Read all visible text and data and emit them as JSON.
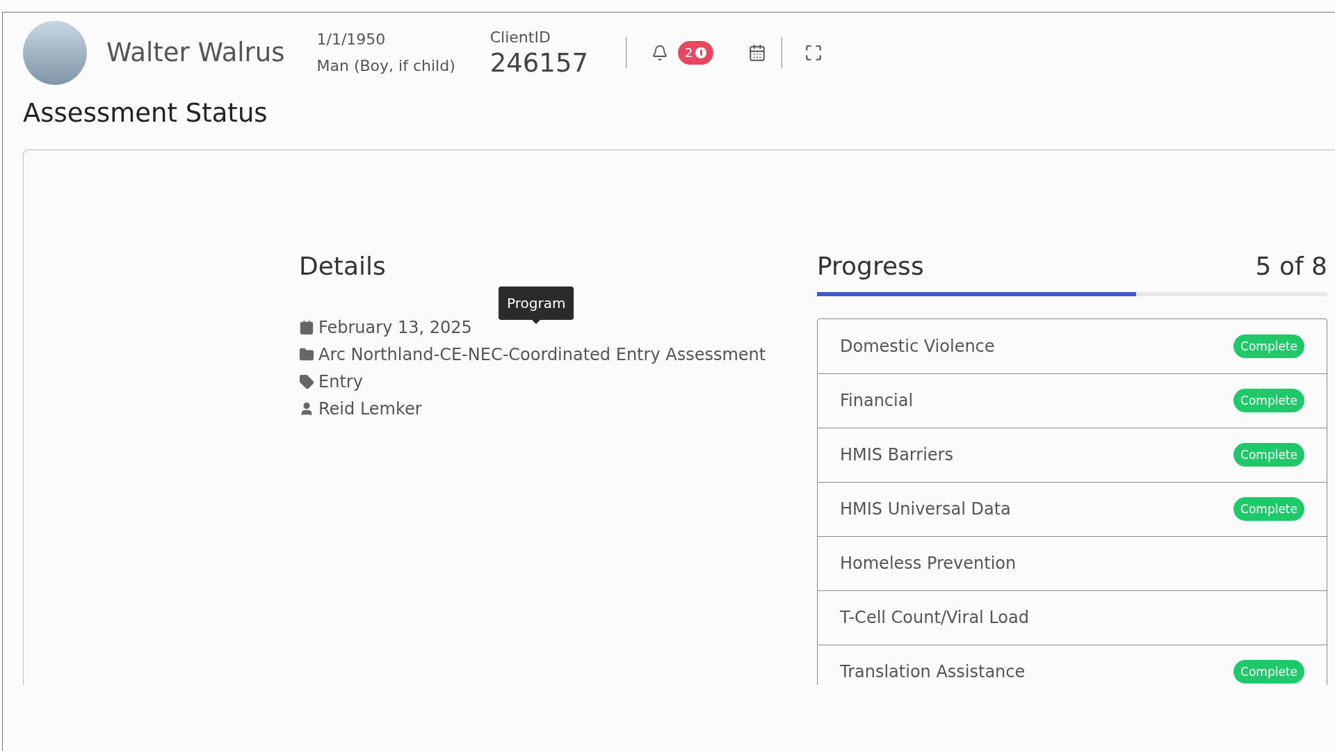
{
  "client": {
    "name": "Walter Walrus",
    "dob": "1/1/1950",
    "gender": "Man (Boy, if child)",
    "id_label": "ClientID",
    "id": "246157",
    "alert_count": "2"
  },
  "page_title": "Assessment Status",
  "details": {
    "heading": "Details",
    "date": "February 13, 2025",
    "program": "Arc Northland-CE-NEC-Coordinated Entry Assessment",
    "type": "Entry",
    "staff": "Reid Lemker",
    "tooltip": "Program"
  },
  "progress": {
    "heading": "Progress",
    "count": "5 of 8",
    "level": 0.625,
    "items": [
      {
        "name": "Domestic Violence",
        "complete": true,
        "badge": "Complete"
      },
      {
        "name": "Financial",
        "complete": true,
        "badge": "Complete"
      },
      {
        "name": "HMIS Barriers",
        "complete": true,
        "badge": "Complete"
      },
      {
        "name": "HMIS Universal Data",
        "complete": true,
        "badge": "Complete"
      },
      {
        "name": "Homeless Prevention",
        "complete": false
      },
      {
        "name": "T-Cell Count/Viral Load",
        "complete": false
      },
      {
        "name": "Translation Assistance",
        "complete": true,
        "badge": "Complete"
      }
    ]
  }
}
